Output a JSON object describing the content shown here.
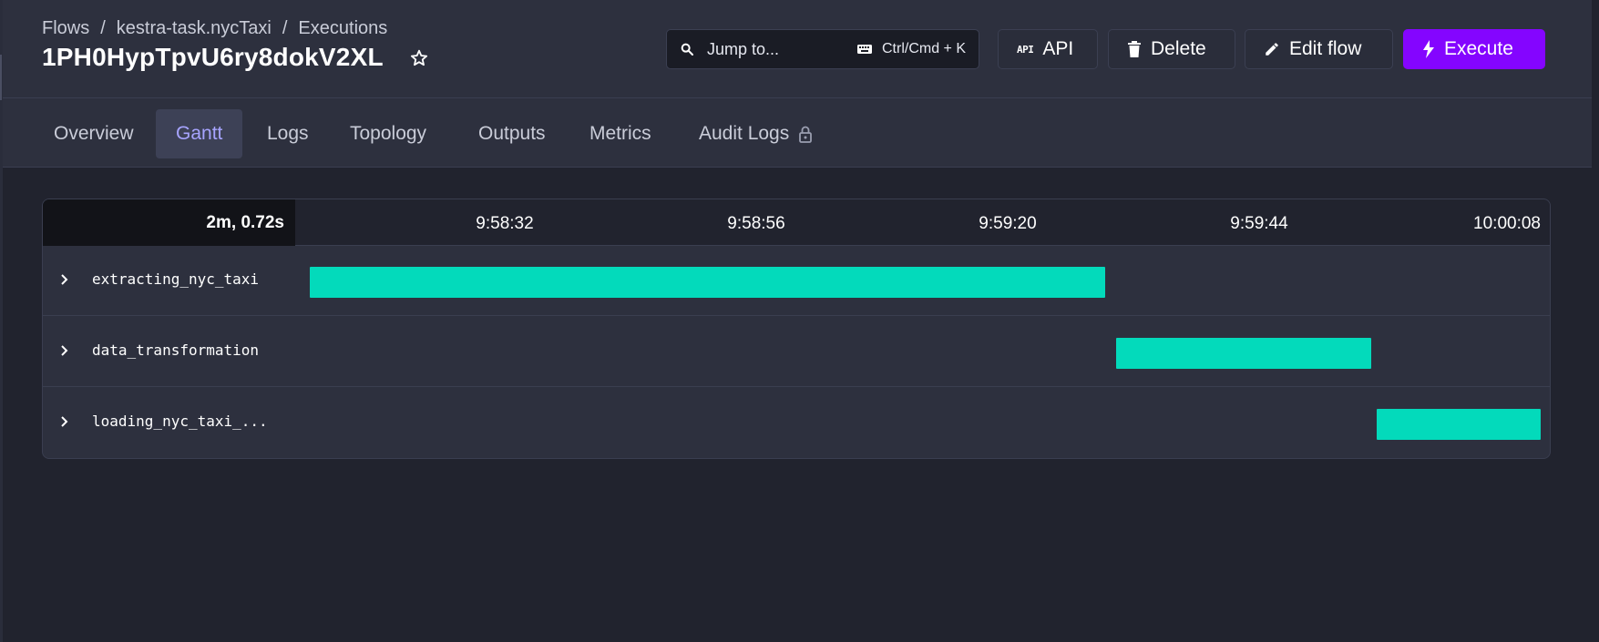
{
  "breadcrumb": {
    "flows": "Flows",
    "flow": "kestra-task.nycTaxi",
    "executions": "Executions",
    "sep1": "/",
    "sep2": "/"
  },
  "title": "1PH0HypTpvU6ry8dokV2XL",
  "jump": {
    "label": "Jump to...",
    "shortcut": "Ctrl/Cmd + K"
  },
  "buttons": {
    "api": "API",
    "delete": "Delete",
    "edit": "Edit flow",
    "execute": "Execute"
  },
  "tabs": [
    "Overview",
    "Gantt",
    "Logs",
    "Topology",
    "Outputs",
    "Metrics",
    "Audit Logs"
  ],
  "active_tab": "Gantt",
  "gantt": {
    "duration": "2m, 0.72s",
    "ticks": [
      "9:58:32",
      "9:58:56",
      "9:59:20",
      "9:59:44",
      "10:00:08"
    ],
    "tasks": [
      {
        "name": "extracting_nyc_taxi",
        "start_fraction": 0.012,
        "end_fraction": 0.65
      },
      {
        "name": "data_transformation",
        "start_fraction": 0.659,
        "end_fraction": 0.864
      },
      {
        "name": "loading_nyc_taxi_...",
        "start_fraction": 0.868,
        "end_fraction": 1.0
      }
    ]
  },
  "colors": {
    "accent": "#8405ff",
    "bar": "#03dabb",
    "active_tab_text": "#a7a4ff"
  }
}
